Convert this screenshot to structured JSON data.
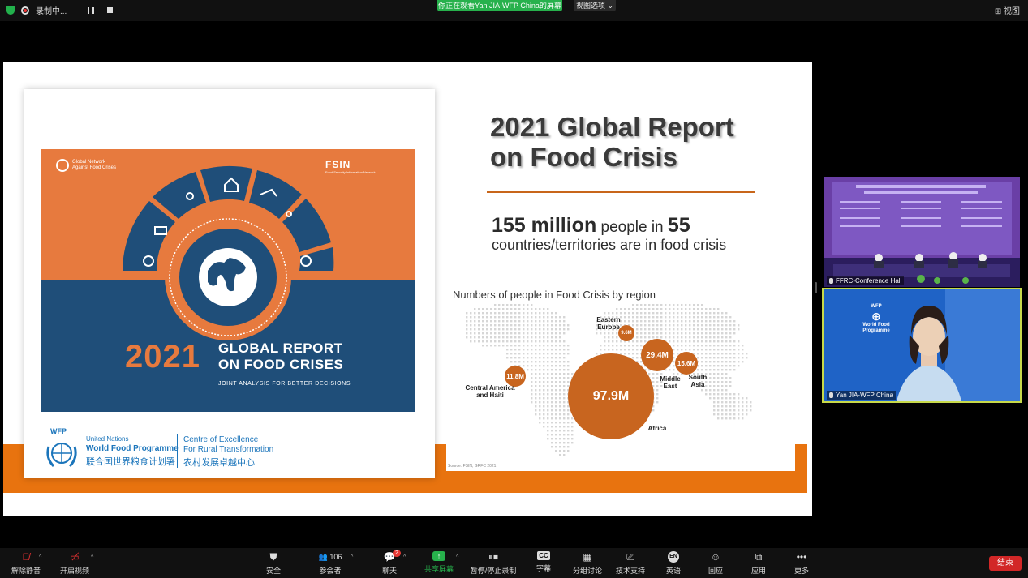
{
  "topbar": {
    "recording_label": "录制中...",
    "viewing_banner": "你正在观看Yan JIA-WFP China的屏幕",
    "view_options": "视图选项",
    "view_button": "视图"
  },
  "slide": {
    "cover": {
      "logo_gn": [
        "Global Network",
        "Against Food Crises"
      ],
      "logo_fsin": "FSIN",
      "logo_fsin_sub": "Food Security Information Network",
      "year": "2021",
      "title_line1": "GLOBAL REPORT",
      "title_line2": "ON FOOD CRISES",
      "subtitle": "JOINT ANALYSIS FOR BETTER DECISIONS"
    },
    "footer_logo": {
      "wfp": "WFP",
      "un": "United Nations",
      "name": "World Food Programme",
      "zh": "联合国世界粮食计划署",
      "coe1": "Centre of Excellence",
      "coe2": "For Rural Transformation",
      "coe3": "农村发展卓越中心"
    },
    "report_title_line1": "2021 Global Report",
    "report_title_line2": "on Food Crisis",
    "stat": {
      "count": "155 million",
      "people_in": " people in ",
      "countries": "55",
      "line2": "countries/territories are in food crisis"
    },
    "map_title": "Numbers of people in Food Crisis by region",
    "source": "Source: FSIN, GRFC 2021",
    "regions": [
      {
        "name_lines": [
          "Central America",
          "and Haiti"
        ],
        "value": "11.8M"
      },
      {
        "name_lines": [
          "Eastern",
          "Europe"
        ],
        "value": "9.6M"
      },
      {
        "name_lines": [
          "Middle",
          "East"
        ],
        "value": "29.4M"
      },
      {
        "name_lines": [
          "South",
          "Asia"
        ],
        "value": "15.6M"
      },
      {
        "name_lines": [
          "Africa"
        ],
        "value": "97.9M"
      }
    ],
    "accent_color": "#c8651f"
  },
  "tiles": [
    {
      "name": "FFRC-Conference Hall"
    },
    {
      "name": "Yan JIA-WFP China",
      "logo": [
        "WFP",
        "World Food",
        "Programme"
      ]
    }
  ],
  "toolbar": {
    "items": [
      {
        "label": "解除静音",
        "icon": "mic-off-icon"
      },
      {
        "label": "开启视频",
        "icon": "video-off-icon"
      },
      {
        "label": "安全",
        "icon": "shield-icon"
      },
      {
        "label": "参会者",
        "icon": "participants-icon",
        "count": "106"
      },
      {
        "label": "聊天",
        "icon": "chat-icon",
        "badge": "2"
      },
      {
        "label": "共享屏幕",
        "icon": "share-screen-icon"
      },
      {
        "label": "暂停/停止录制",
        "icon": "pause-stop-icon"
      },
      {
        "label": "字幕",
        "icon": "cc-icon"
      },
      {
        "label": "分组讨论",
        "icon": "breakout-icon"
      },
      {
        "label": "技术支持",
        "icon": "support-icon"
      },
      {
        "label": "英语",
        "icon": "language-icon",
        "code": "EN"
      },
      {
        "label": "回应",
        "icon": "reaction-icon"
      },
      {
        "label": "应用",
        "icon": "apps-icon"
      },
      {
        "label": "更多",
        "icon": "more-icon"
      }
    ],
    "end_label": "结束"
  }
}
